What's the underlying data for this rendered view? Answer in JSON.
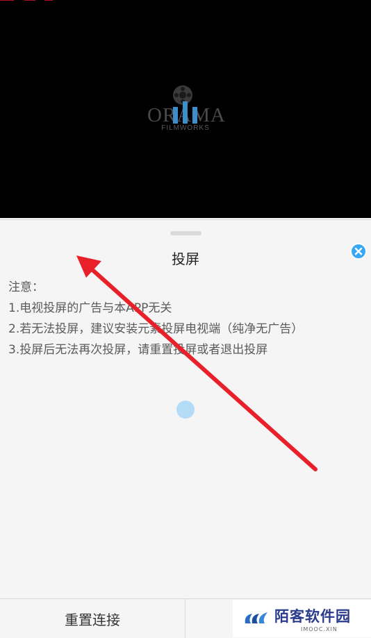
{
  "video": {
    "logo_text": "ORAMA",
    "logo_sub": "FILMWORKS"
  },
  "sheet": {
    "title": "投屏",
    "notes": [
      "注意：",
      "1.电视投屏的广告与本APP无关",
      "2.若无法投屏，建议安装元素投屏电视端（纯净无广告）",
      "3.投屏后无法再次投屏，请重置投屏或者退出投屏"
    ],
    "close_icon": "close-icon"
  },
  "bottom": {
    "reset_label": "重置连接"
  },
  "watermark": {
    "title": "陌客软件园",
    "sub": "IMOOC.XIN"
  },
  "colors": {
    "accent": "#38a8f2",
    "arrow": "#e8202a",
    "spinner": "#b5dcf7"
  }
}
